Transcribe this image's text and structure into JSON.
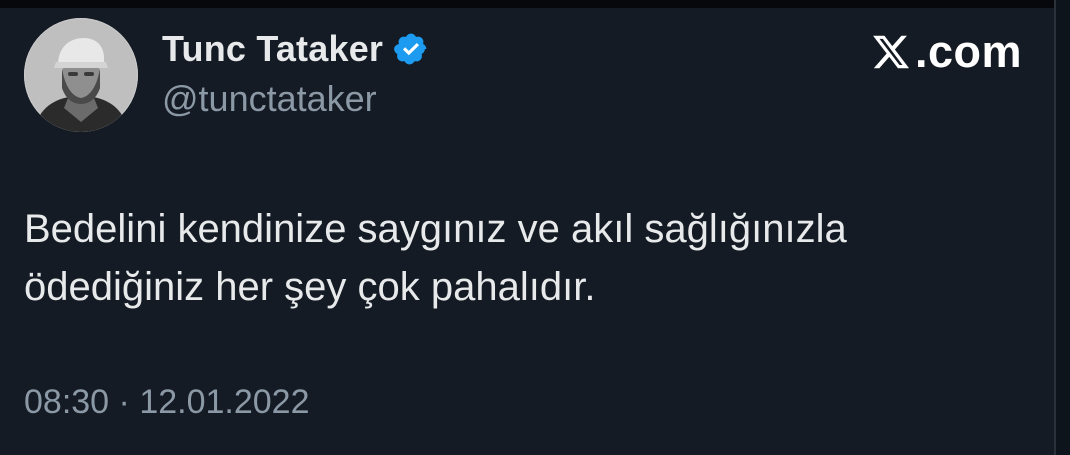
{
  "author": {
    "display_name": "Tunc Tataker",
    "handle": "@tunctataker",
    "verified": true,
    "avatar_icon": "profile-photo"
  },
  "brand": {
    "label": ".com",
    "logo_icon": "x-logo-icon"
  },
  "tweet": {
    "lines": [
      "Bedelini kendinize saygınız ve akıl sağlığınızla",
      "ödediğiniz her şey çok pahalıdır."
    ]
  },
  "meta": {
    "time": "08:30",
    "separator": "·",
    "date": "12.01.2022"
  },
  "colors": {
    "background": "#141b24",
    "primary_text": "#e7e9ea",
    "secondary_text": "#8b98a5",
    "verified_blue": "#1d9bf0"
  }
}
